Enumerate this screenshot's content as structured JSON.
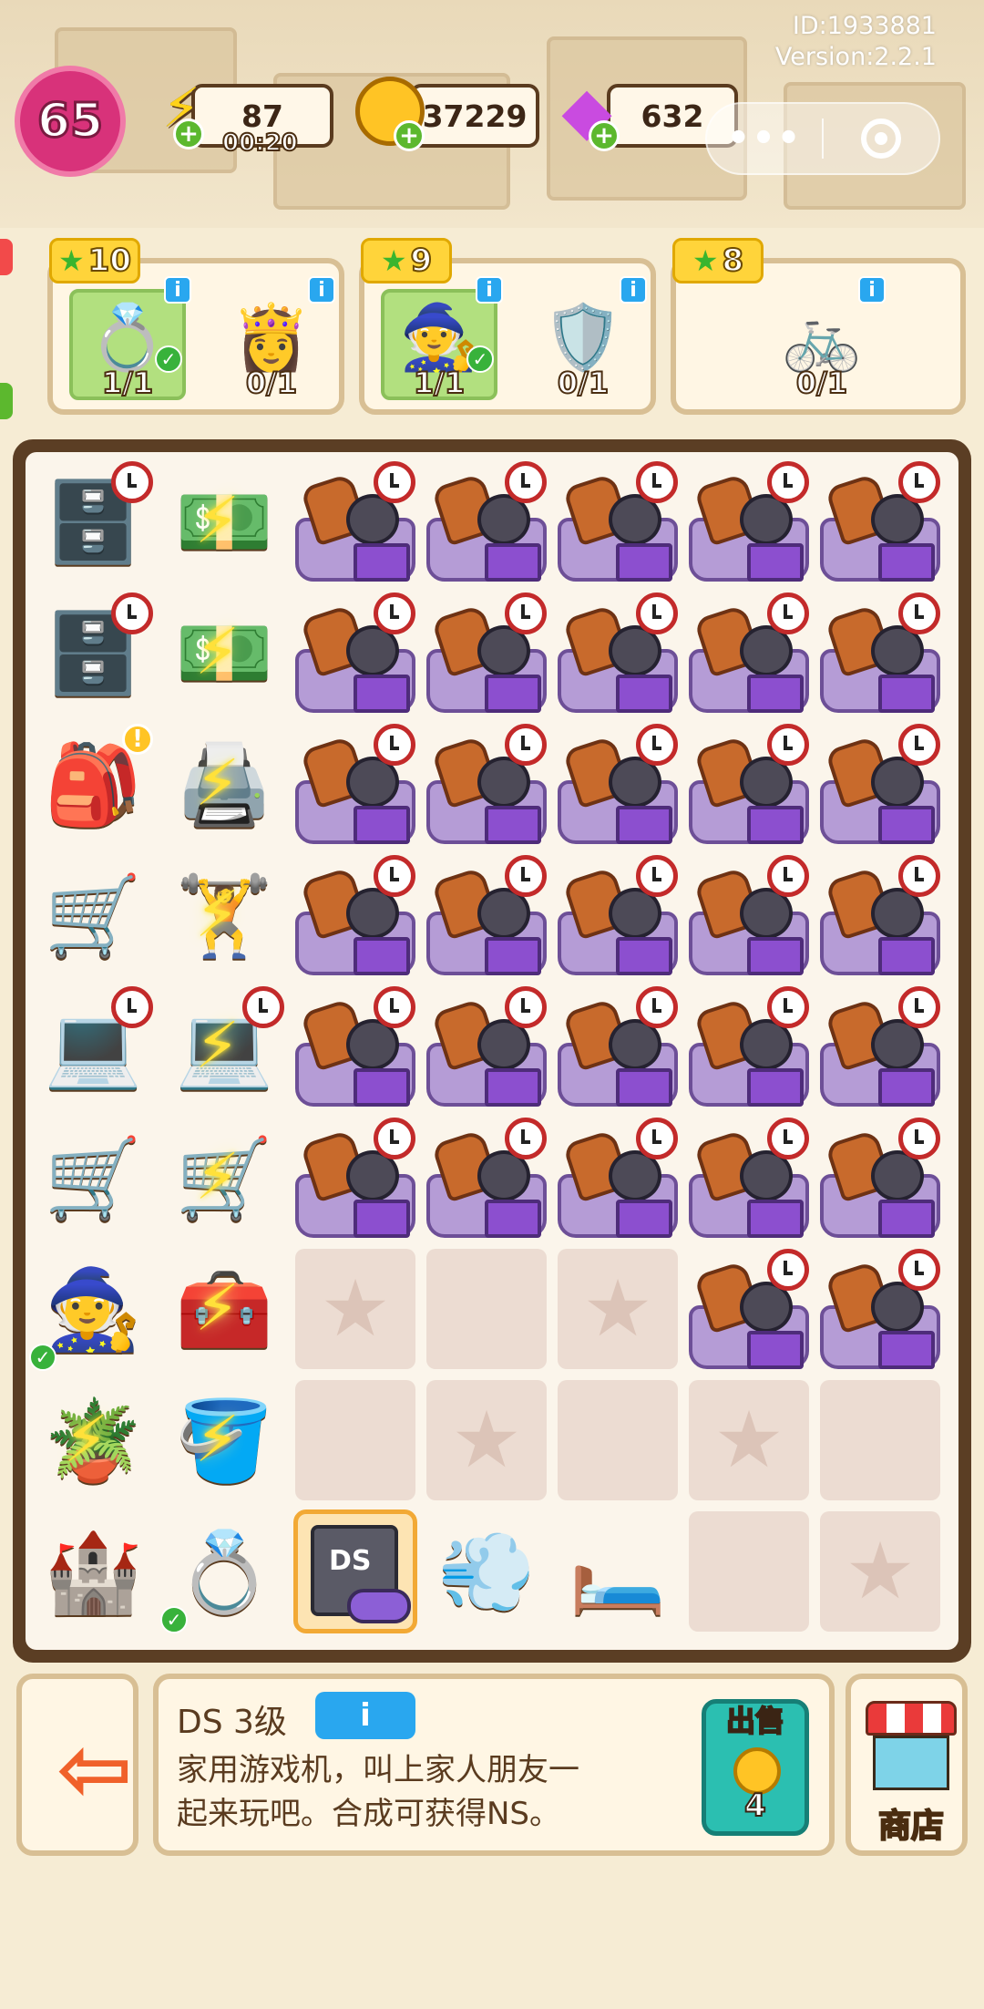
{
  "meta": {
    "id_text": "ID:1933881",
    "version_text": "Version:2.2.1"
  },
  "hud": {
    "level": "65",
    "energy": "87",
    "energy_timer": "00:20",
    "coins": "37229",
    "gems": "632"
  },
  "orders": [
    {
      "stars": "10",
      "items": [
        {
          "icon": "golden-ring",
          "progress": "1/1",
          "done": true
        },
        {
          "icon": "princess-duck",
          "progress": "0/1",
          "done": false
        }
      ]
    },
    {
      "stars": "9",
      "items": [
        {
          "icon": "wizard-duck",
          "progress": "1/1",
          "done": true
        },
        {
          "icon": "warrior-figure",
          "progress": "0/1",
          "done": false
        }
      ]
    },
    {
      "stars": "8",
      "items": [
        {
          "icon": "exercise-bike",
          "progress": "0/1",
          "done": false
        }
      ]
    }
  ],
  "board": {
    "item_glyphs": {
      "locker": "🗄️",
      "cash-register": "💵",
      "pink-backpack": "🎒",
      "blue-printer": "🖨️",
      "gym-cart": "🛒",
      "exercise-machine": "🏋️",
      "laptop": "💻",
      "shopping-cart-duck": "🛒",
      "wizard-duck": "🧙",
      "tool-cart": "🧰",
      "sprout-pot": "🪴",
      "empty-pot": "🪣",
      "castle": "🏰",
      "golden-ring": "💍",
      "hair-dryer": "💨",
      "pillow": "🛏️"
    }
  },
  "selected": {
    "title": "DS 3级",
    "info": "i",
    "description_line1": "家用游戏机，叫上家人朋友一",
    "description_line2": "起来玩吧。合成可获得NS。",
    "sell_label": "出售",
    "sell_value": "4",
    "ds_label": "DS"
  },
  "buttons": {
    "shop_label": "商店"
  },
  "colors": {
    "board_border": "#5b3e24",
    "accent_info": "#29a7ef",
    "sell_bg": "#2bbfb1"
  }
}
